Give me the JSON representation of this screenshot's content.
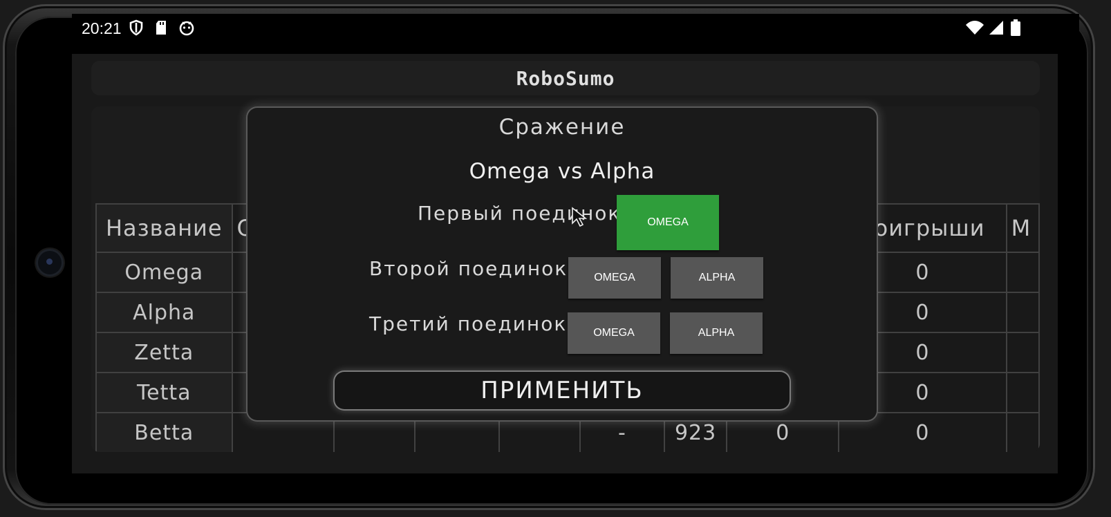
{
  "status_bar": {
    "time": "20:21",
    "icons": [
      "shield-icon",
      "sd-card-icon",
      "notification-app-icon",
      "wifi-icon",
      "signal-icon",
      "battery-icon"
    ]
  },
  "app": {
    "title": "RoboSumo"
  },
  "table": {
    "headers": [
      "Название",
      "О",
      "",
      "",
      "",
      "",
      "",
      "",
      "Проигрыши",
      "М"
    ],
    "rows": [
      {
        "name": "Omega",
        "cells": [
          "",
          "",
          "",
          "",
          "",
          "",
          "",
          "0",
          ""
        ]
      },
      {
        "name": "Alpha",
        "cells": [
          "",
          "",
          "",
          "",
          "",
          "",
          "",
          "0",
          ""
        ]
      },
      {
        "name": "Zetta",
        "cells": [
          "",
          "",
          "",
          "",
          "",
          "",
          "",
          "0",
          ""
        ]
      },
      {
        "name": "Tetta",
        "cells": [
          "",
          "",
          "",
          "",
          "",
          "",
          "",
          "0",
          ""
        ]
      },
      {
        "name": "Betta",
        "cells": [
          "",
          "",
          "",
          "",
          "-",
          "923",
          "0",
          "0",
          ""
        ]
      }
    ]
  },
  "dialog": {
    "title": "Сражение",
    "matchup": "Omega vs Alpha",
    "rounds": [
      {
        "label": "Первый поединок",
        "buttons": [
          "OMEGA"
        ],
        "selected": "OMEGA"
      },
      {
        "label": "Второй поединок",
        "buttons": [
          "OMEGA",
          "ALPHA"
        ],
        "selected": null
      },
      {
        "label": "Третий поединок",
        "buttons": [
          "OMEGA",
          "ALPHA"
        ],
        "selected": null
      }
    ],
    "apply_label": "ПРИМЕНИТЬ"
  },
  "colors": {
    "selected_button": "#2f9e3b",
    "button": "#565656",
    "background": "#191919"
  }
}
